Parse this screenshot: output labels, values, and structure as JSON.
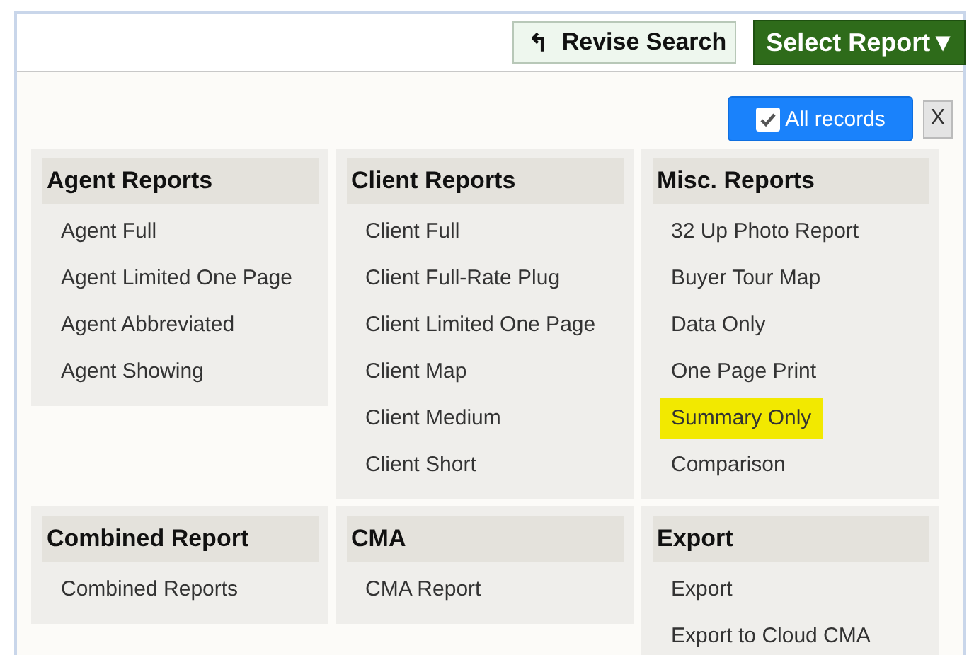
{
  "toolbar": {
    "revise_button": {
      "icon": "↰",
      "label": "Revise Search"
    },
    "select_report_button": {
      "label": "Select Report",
      "caret": "▼"
    }
  },
  "filter": {
    "all_records": {
      "label": "All records",
      "checked": true
    },
    "close": {
      "label": "X"
    }
  },
  "sections": [
    {
      "title": "Agent Reports",
      "items": [
        {
          "label": "Agent Full",
          "selected": false
        },
        {
          "label": "Agent Limited One Page",
          "selected": false
        },
        {
          "label": "Agent Abbreviated",
          "selected": false
        },
        {
          "label": "Agent Showing",
          "selected": false
        }
      ]
    },
    {
      "title": "Client Reports",
      "items": [
        {
          "label": "Client Full",
          "selected": false
        },
        {
          "label": "Client Full-Rate Plug",
          "selected": false
        },
        {
          "label": "Client Limited One Page",
          "selected": false
        },
        {
          "label": "Client Map",
          "selected": false
        },
        {
          "label": "Client Medium",
          "selected": false
        },
        {
          "label": "Client Short",
          "selected": false
        }
      ]
    },
    {
      "title": "Misc. Reports",
      "items": [
        {
          "label": "32 Up Photo Report",
          "selected": false
        },
        {
          "label": "Buyer Tour Map",
          "selected": false
        },
        {
          "label": "Data Only",
          "selected": false
        },
        {
          "label": "One Page Print",
          "selected": false
        },
        {
          "label": "Summary Only",
          "selected": true
        },
        {
          "label": "Comparison",
          "selected": false
        }
      ]
    },
    {
      "title": "Combined Report",
      "items": [
        {
          "label": "Combined Reports",
          "selected": false
        }
      ]
    },
    {
      "title": "CMA",
      "items": [
        {
          "label": "CMA Report",
          "selected": false
        }
      ]
    },
    {
      "title": "Export",
      "items": [
        {
          "label": "Export",
          "selected": false
        },
        {
          "label": "Export to Cloud CMA",
          "selected": false
        }
      ]
    }
  ]
}
